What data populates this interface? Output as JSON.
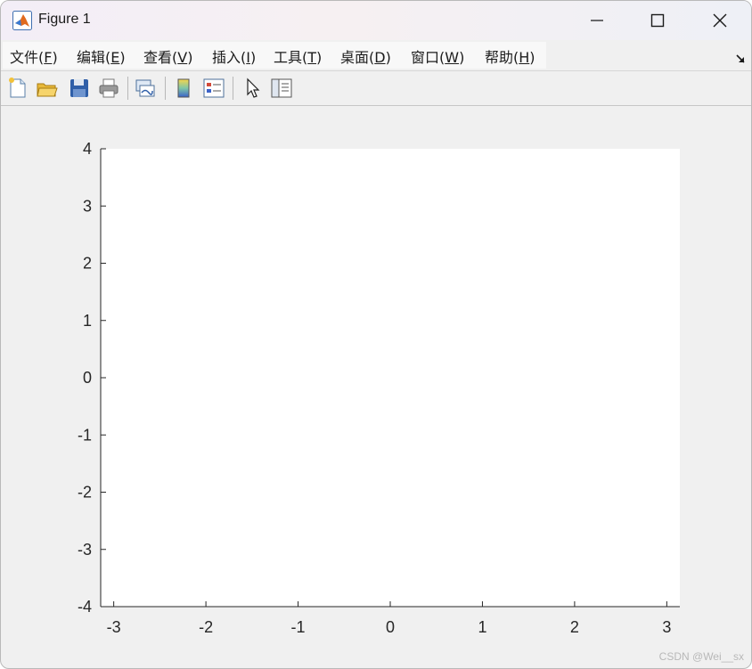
{
  "window": {
    "title": "Figure 1"
  },
  "menu": {
    "items": [
      {
        "label": "文件(",
        "key": "F",
        "tail": ")"
      },
      {
        "label": "编辑(",
        "key": "E",
        "tail": ")"
      },
      {
        "label": "查看(",
        "key": "V",
        "tail": ")"
      },
      {
        "label": "插入(",
        "key": "I",
        "tail": ")"
      },
      {
        "label": "工具(",
        "key": "T",
        "tail": ")"
      },
      {
        "label": "桌面(",
        "key": "D",
        "tail": ")"
      },
      {
        "label": "窗口(",
        "key": "W",
        "tail": ")"
      },
      {
        "label": "帮助(",
        "key": "H",
        "tail": ")"
      }
    ]
  },
  "toolbar": {
    "icons": [
      "new-figure-icon",
      "open-file-icon",
      "save-icon",
      "print-icon",
      "link-plot-icon",
      "colorbar-icon",
      "legend-icon",
      "edit-plot-icon",
      "property-inspector-icon"
    ]
  },
  "watermark": "CSDN @Wei__sx",
  "chart_data": {
    "type": "line",
    "title": "",
    "xlabel": "",
    "ylabel": "",
    "xlim": [
      -3.14159,
      3.14159
    ],
    "ylim": [
      -4,
      4
    ],
    "xticks": [
      "-3",
      "-2",
      "-1",
      "0",
      "1",
      "2",
      "3"
    ],
    "xtick_values": [
      -3,
      -2,
      -1,
      0,
      1,
      2,
      3
    ],
    "yticks": [
      "4",
      "3",
      "2",
      "1",
      "0",
      "-1",
      "-2",
      "-3",
      "-4"
    ],
    "ytick_values": [
      4,
      3,
      2,
      1,
      0,
      -1,
      -2,
      -3,
      -4
    ],
    "grid": false,
    "series": []
  }
}
